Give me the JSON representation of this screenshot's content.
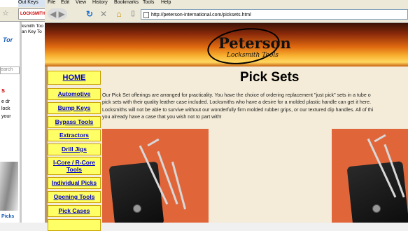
{
  "background_window": {
    "tab_title": "Out Keys",
    "tab2_title": "LOCKSMITH TOO",
    "right_lines": [
      "ksmith Too",
      "an Key To"
    ],
    "left_lines": [
      "Tor",
      "earch",
      "s",
      "e dr",
      "lock",
      "your",
      "Picks"
    ]
  },
  "browser": {
    "menu": [
      "File",
      "Edit",
      "View",
      "History",
      "Bookmarks",
      "Tools",
      "Help"
    ],
    "url": "http://peterson-international.com/picksets.html",
    "nav_icons": [
      "back-icon",
      "forward-icon",
      "reload-icon",
      "stop-icon",
      "home-icon"
    ]
  },
  "site": {
    "logo_name": "Peterson",
    "logo_sub": "Locksmith Tools",
    "page_title": "Pick Sets",
    "nav": [
      "HOME",
      "Automotive",
      "Bump Keys",
      "Bypass Tools",
      "Extractors",
      "Drill Jigs",
      "I-Core / R-Core Tools",
      "Individual Picks",
      "Opening Tools",
      "Pick Cases"
    ],
    "intro_lines": [
      "Our Pick Set offerings are arranged for practicality. You have the choice of ordering replacement \"just pick\" sets in a tube o",
      "pick sets with their quality leather case included. Locksmiths who have a desire for a molded plastic handle can get it here.",
      "Locksmiths will not be able to survive without our wonderfully firm molded rubber grips, or our textured dip handles. All of thi",
      "you already have a case that you wish not to part with!"
    ]
  },
  "colors": {
    "nav_button_bg": "#ffff66",
    "nav_link": "#0000cc",
    "content_bg": "#f4ecd8",
    "photo_bg": "#e0663a"
  }
}
